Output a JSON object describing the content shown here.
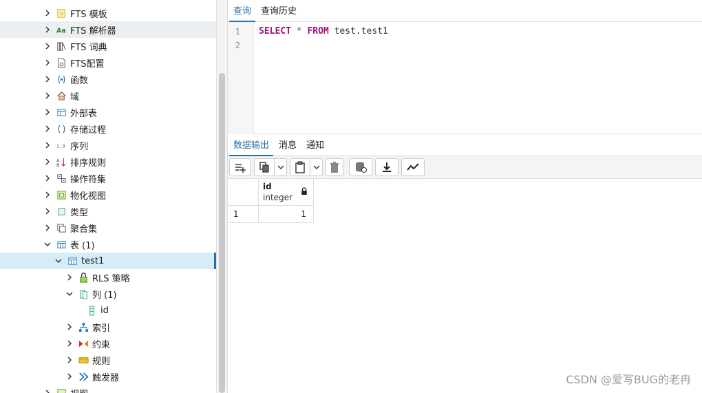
{
  "tree": {
    "items": [
      {
        "label": "FTS 模板",
        "icon": "fts-template-icon"
      },
      {
        "label": "FTS 解析器",
        "icon": "fts-parser-icon"
      },
      {
        "label": "FTS 词典",
        "icon": "fts-dictionary-icon"
      },
      {
        "label": "FTS配置",
        "icon": "fts-config-icon"
      },
      {
        "label": "函数",
        "icon": "function-icon"
      },
      {
        "label": "域",
        "icon": "domain-icon"
      },
      {
        "label": "外部表",
        "icon": "foreign-table-icon"
      },
      {
        "label": "存储过程",
        "icon": "procedure-icon"
      },
      {
        "label": "序列",
        "icon": "sequence-icon"
      },
      {
        "label": "排序规则",
        "icon": "collation-icon"
      },
      {
        "label": "操作符集",
        "icon": "operator-icon"
      },
      {
        "label": "物化视图",
        "icon": "materialized-view-icon"
      },
      {
        "label": "类型",
        "icon": "type-icon"
      },
      {
        "label": "聚合集",
        "icon": "aggregate-icon"
      },
      {
        "label": "表 (1)",
        "icon": "tables-icon"
      },
      {
        "label": "test1",
        "icon": "table-icon"
      },
      {
        "label": "RLS 策略",
        "icon": "rls-policy-icon"
      },
      {
        "label": "列 (1)",
        "icon": "columns-icon"
      },
      {
        "label": "id",
        "icon": "column-icon"
      },
      {
        "label": "索引",
        "icon": "index-icon"
      },
      {
        "label": "约束",
        "icon": "constraint-icon"
      },
      {
        "label": "规则",
        "icon": "rule-icon"
      },
      {
        "label": "触发器",
        "icon": "trigger-icon"
      },
      {
        "label": "视图",
        "icon": "view-icon"
      }
    ],
    "sequence_icon_text": "1..3"
  },
  "query_tabs": [
    "查询",
    "查询历史"
  ],
  "editor": {
    "line_numbers": [
      "1",
      "2"
    ],
    "kw_select": "SELECT",
    "op_star": " * ",
    "kw_from": "FROM",
    "table_ref": " test.test1"
  },
  "result_tabs": [
    "数据输出",
    "消息",
    "通知"
  ],
  "toolbar": {
    "icons": [
      "add-row-icon",
      "copy-icon",
      "paste-icon",
      "delete-icon",
      "save-data-icon",
      "download-icon",
      "graph-icon"
    ]
  },
  "grid": {
    "column_name": "id",
    "column_type": "integer",
    "row_number": "1",
    "cell_value": "1"
  },
  "watermark": "CSDN @爱写BUG的老冉",
  "colors": {
    "accent": "#2b6ea6",
    "keyword": "#a0117a",
    "selected_row": "#d6ecf9"
  }
}
